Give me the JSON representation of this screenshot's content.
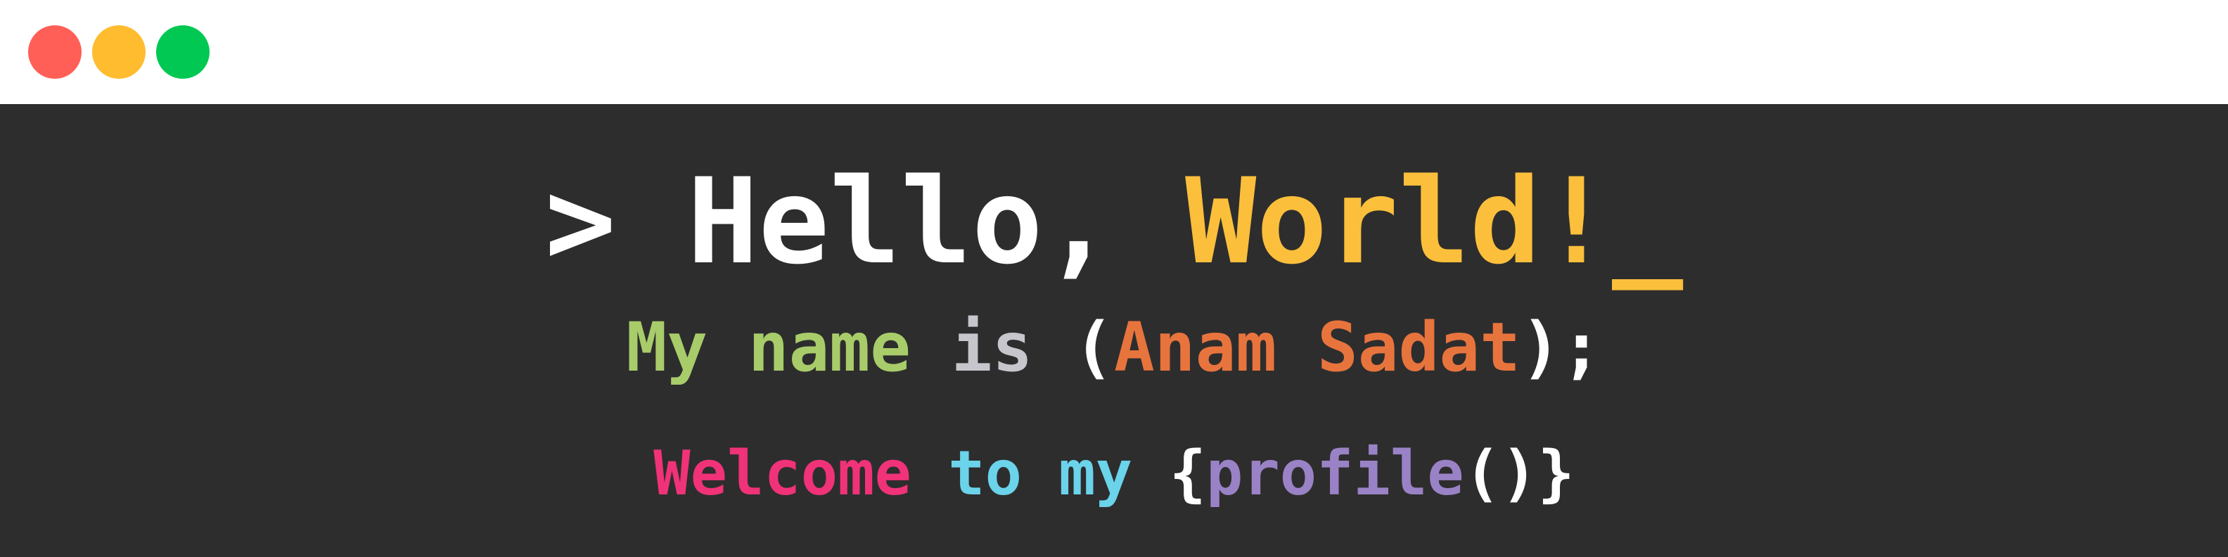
{
  "window": {
    "controls": [
      {
        "name": "close",
        "color": "#ff5f57"
      },
      {
        "name": "minimize",
        "color": "#febc2e"
      },
      {
        "name": "zoom",
        "color": "#00c853"
      }
    ]
  },
  "terminal": {
    "line1": {
      "prompt": ">",
      "hello": "Hello,",
      "world": "World!",
      "cursor": "_"
    },
    "line2": {
      "my": "My",
      "name": "name",
      "is": "is",
      "open_paren": "(",
      "name_value": "Anam Sadat",
      "close_paren": ")",
      "semicolon": ";"
    },
    "line3": {
      "welcome": "Welcome",
      "to": "to",
      "my": "my",
      "open_brace": "{",
      "profile": "profile",
      "call_parens": "()",
      "close_brace": "}"
    }
  },
  "colors": {
    "background": "#2d2d2d",
    "titlebar": "#ffffff",
    "white": "#ffffff",
    "yellow": "#fbbf3c",
    "green": "#a8cc6a",
    "gray": "#c6c6cc",
    "orange": "#e8743d",
    "pink": "#f03278",
    "cyan": "#6bd3ea",
    "purple": "#9a82c6"
  }
}
